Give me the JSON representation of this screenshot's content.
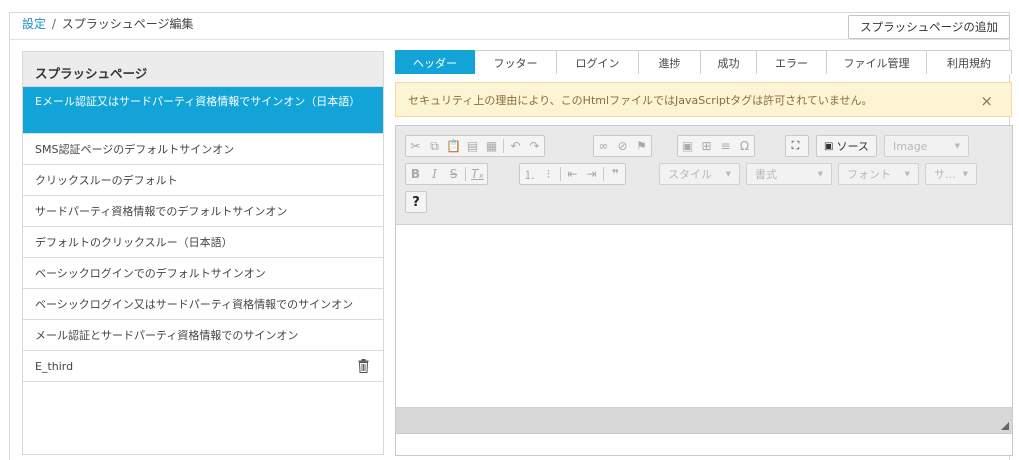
{
  "breadcrumb": {
    "parent": "設定",
    "separator": "/",
    "current": "スプラッシュページ編集"
  },
  "add_button": "スプラッシュページの追加",
  "sidebar": {
    "title": "スプラッシュページ",
    "items": [
      {
        "label": "Eメール認証又はサードパーティ資格情報でサインオン（日本語）",
        "active": true
      },
      {
        "label": "SMS認証ページのデフォルトサインオン"
      },
      {
        "label": "クリックスルーのデフォルト"
      },
      {
        "label": "サードパーティ資格情報でのデフォルトサインオン"
      },
      {
        "label": "デフォルトのクリックスルー（日本語）"
      },
      {
        "label": "ベーシックログインでのデフォルトサインオン"
      },
      {
        "label": "ベーシックログイン又はサードパーティ資格情報でのサインオン"
      },
      {
        "label": "メール認証とサードパーティ資格情報でのサインオン"
      },
      {
        "label": "E_third",
        "icon": "trash-icon"
      }
    ]
  },
  "tabs": [
    {
      "label": "ヘッダー",
      "active": true
    },
    {
      "label": "フッター"
    },
    {
      "label": "ログイン"
    },
    {
      "label": "進捗"
    },
    {
      "label": "成功"
    },
    {
      "label": "エラー"
    },
    {
      "label": "ファイル管理"
    },
    {
      "label": "利用規約"
    }
  ],
  "warning": {
    "text": "セキュリティ上の理由により、このHtmlファイルではJavaScriptタグは許可されていません。",
    "close": "×"
  },
  "toolbar": {
    "source_label": "ソース",
    "image_label": "Image",
    "style_label": "スタイル",
    "format_label": "書式",
    "font_label": "フォント",
    "size_label": "サ...",
    "help_label": "?"
  },
  "colors": {
    "accent": "#12a4d6",
    "warning_bg": "#fdf4d4",
    "warning_text": "#8a6d3b"
  }
}
